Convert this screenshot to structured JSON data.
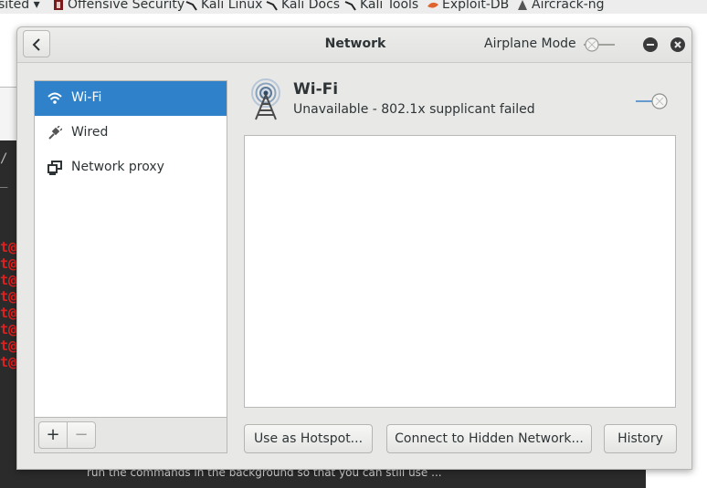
{
  "bookmarks": [
    {
      "label": "sited",
      "icon": "chevron-down-icon"
    },
    {
      "label": "Offensive Security",
      "icon": "offsec-icon"
    },
    {
      "label": "Kali Linux",
      "icon": "kali-dragon-icon"
    },
    {
      "label": "Kali Docs",
      "icon": "kali-dragon-icon"
    },
    {
      "label": "Kali Tools",
      "icon": "kali-dragon-icon"
    },
    {
      "label": "Exploit-DB",
      "icon": "exploit-db-icon"
    },
    {
      "label": "Aircrack-ng",
      "icon": "aircrack-icon"
    }
  ],
  "terminal": {
    "prompt_fragment": "t@",
    "prompt_lines": [
      "t@",
      "t@",
      "t@",
      "t@",
      "t@",
      "t@",
      "t@",
      "t@"
    ],
    "bottom_text": "run the commands in the background so that you can still use ..."
  },
  "dialog": {
    "title": "Network",
    "airplane_mode_label": "Airplane Mode",
    "airplane_mode_on": false,
    "sidebar": {
      "items": [
        {
          "label": "Wi-Fi",
          "icon": "wifi-icon",
          "selected": true
        },
        {
          "label": "Wired",
          "icon": "wired-plug-icon",
          "selected": false
        },
        {
          "label": "Network proxy",
          "icon": "network-proxy-icon",
          "selected": false
        }
      ],
      "add_label": "+",
      "remove_label": "−"
    },
    "main": {
      "title": "Wi-Fi",
      "status": "Unavailable - 802.1x supplicant failed",
      "wifi_switch_on": false,
      "buttons": {
        "hotspot": "Use as Hotspot...",
        "hidden_network": "Connect to Hidden Network...",
        "history": "History"
      }
    }
  },
  "colors": {
    "selection": "#2f82c9",
    "terminal_bg": "#2b2b2b",
    "terminal_prompt": "#e0201f"
  }
}
